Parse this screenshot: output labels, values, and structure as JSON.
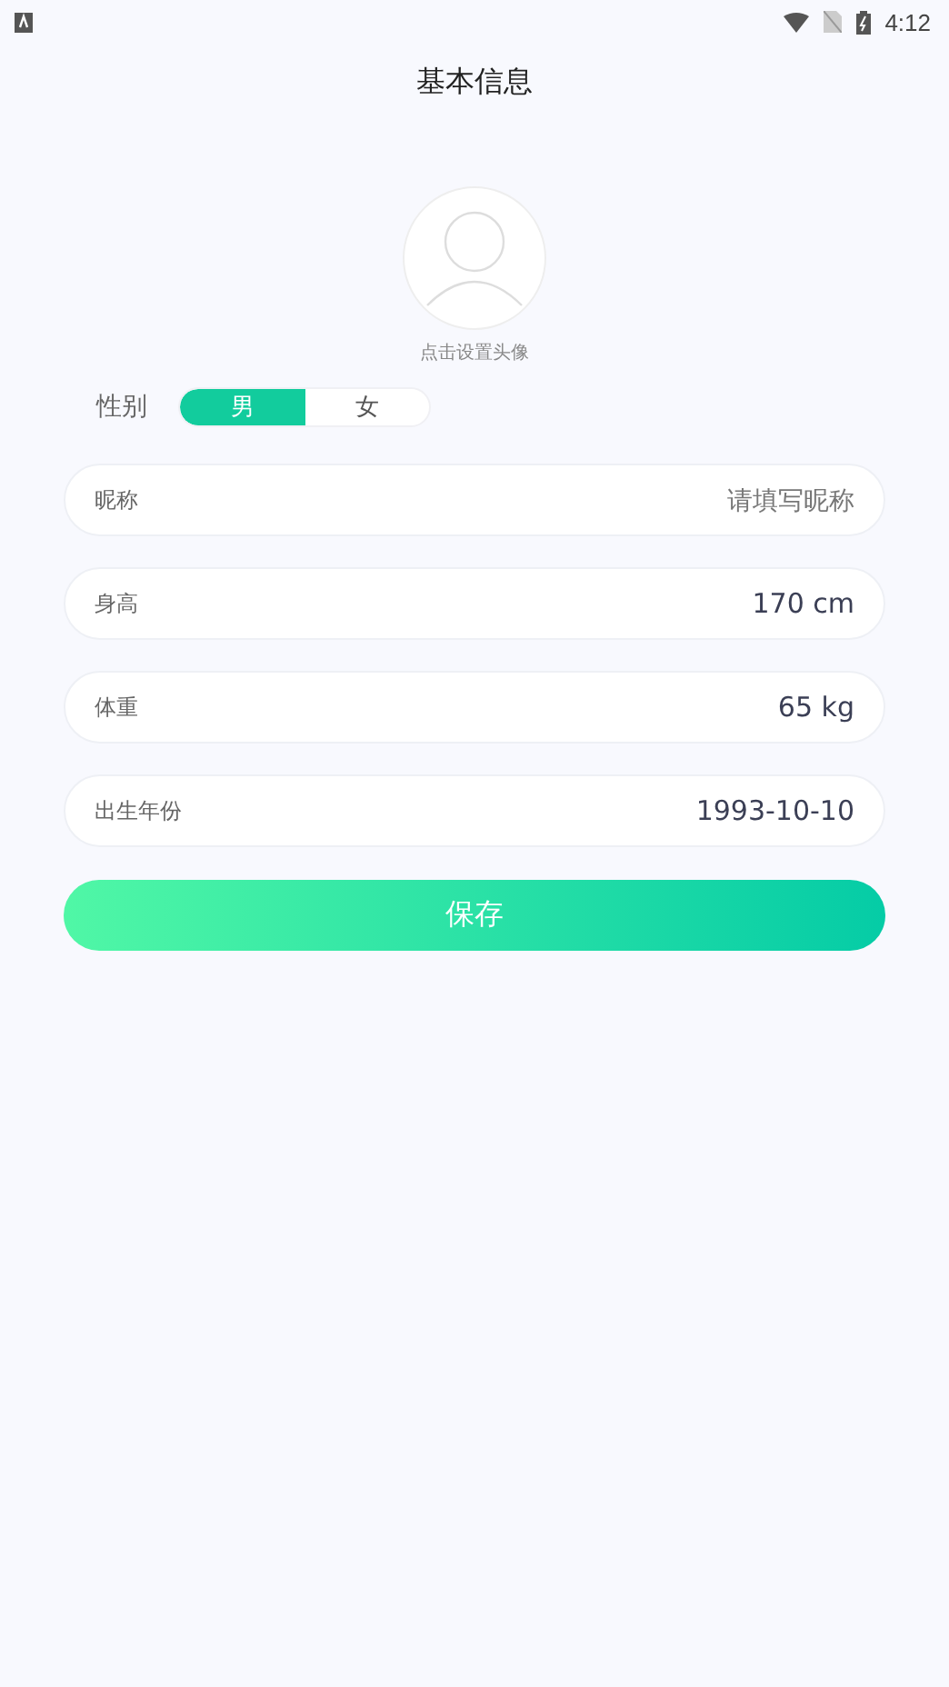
{
  "status_bar": {
    "time": "4:12"
  },
  "title": "基本信息",
  "avatar": {
    "caption": "点击设置头像"
  },
  "gender": {
    "label": "性别",
    "options": [
      {
        "label": "男",
        "selected": true
      },
      {
        "label": "女",
        "selected": false
      }
    ]
  },
  "fields": [
    {
      "label": "昵称",
      "placeholder": "请填写昵称"
    },
    {
      "label": "身高",
      "value": "170 cm"
    },
    {
      "label": "体重",
      "value": "65 kg"
    },
    {
      "label": "出生年份",
      "value": "1993-10-10"
    }
  ],
  "save_button": "保存"
}
